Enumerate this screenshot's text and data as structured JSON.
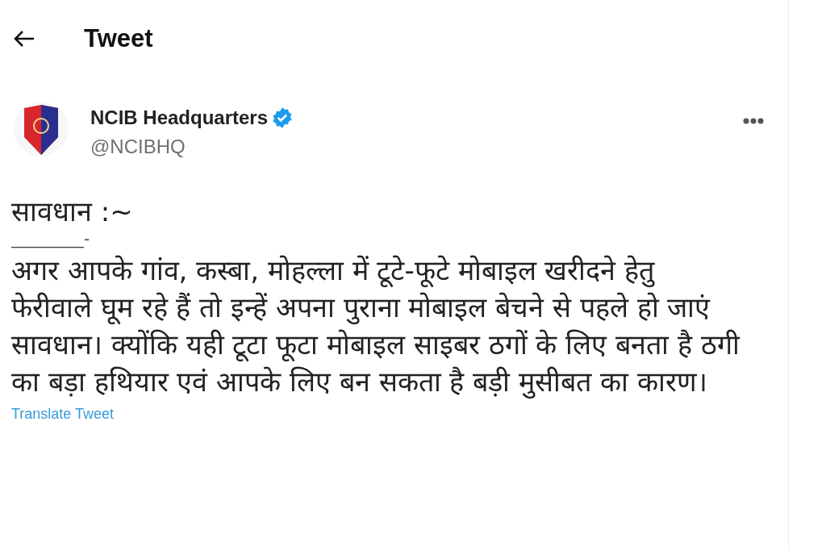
{
  "header": {
    "title": "Tweet"
  },
  "author": {
    "name": "NCIB Headquarters",
    "verified": true,
    "handle": "@NCIBHQ"
  },
  "tweet": {
    "heading": "सावधान :~",
    "separator": "_________-",
    "body": "अगर आपके गांव, कस्बा, मोहल्ला में टूटे-फूटे मोबाइल खरीदने हेतु फेरीवाले घूम रहे हैं तो इन्हें अपना पुराना मोबाइल बेचने से पहले हो जाएं सावधान। क्योंकि यही टूटा फूटा मोबाइल साइबर ठगों के लिए बनता है ठगी का बड़ा हथियार एवं आपके लिए बन सकता है बड़ी मुसीबत का कारण।",
    "translate_link": "Translate Tweet"
  }
}
